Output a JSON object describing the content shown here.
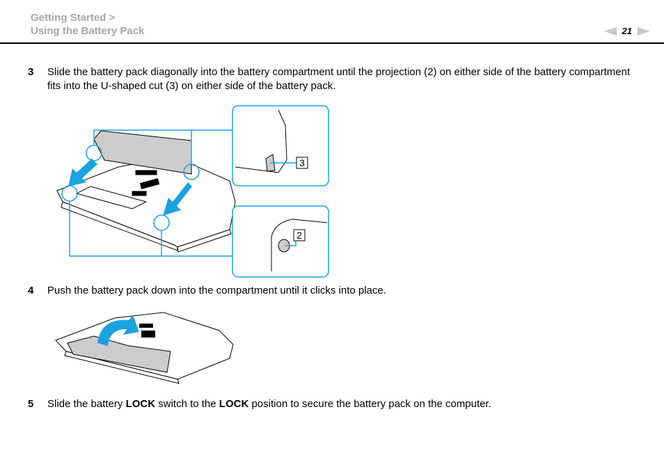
{
  "header": {
    "breadcrumb": [
      "Getting Started >",
      "Using the Battery Pack"
    ],
    "page_number": "21",
    "prev_icon": "triangle-left-icon",
    "next_icon": "triangle-right-icon"
  },
  "colors": {
    "accent": "#1aa3e0",
    "breadcrumb": "#a6a6a6",
    "battery_fill": "#cccccc"
  },
  "steps": [
    {
      "number": "3",
      "text": "Slide the battery pack diagonally into the battery compartment until the projection (2) on either side of the battery compartment fits into the U-shaped cut (3) on either side of the battery pack."
    },
    {
      "number": "4",
      "text": "Push the battery pack down into the compartment until it clicks into place."
    },
    {
      "number": "5",
      "text_parts": [
        "Slide the battery ",
        "LOCK",
        " switch to the ",
        "LOCK",
        " position to secure the battery pack on the computer."
      ]
    }
  ],
  "figures": {
    "insert": {
      "callouts": [
        "3",
        "2"
      ]
    },
    "push": {}
  }
}
